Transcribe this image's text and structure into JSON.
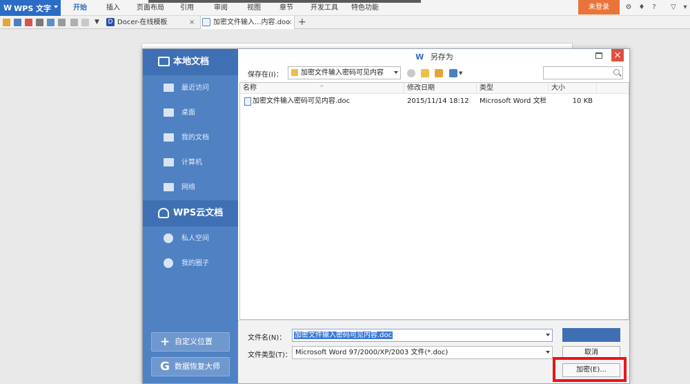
{
  "app": {
    "name": "WPS 文字",
    "logo": "W",
    "menus": [
      "开始",
      "插入",
      "页面布局",
      "引用",
      "审阅",
      "视图",
      "章节",
      "开发工具",
      "特色功能"
    ],
    "active_menu": "开始",
    "login_label": "未登录",
    "accent_color": "#2b6cc4",
    "login_color": "#e8743b"
  },
  "tabs": {
    "docer_label": "Docer-在线模板",
    "docer_icon": "D",
    "active_doc_label": "加密文件输入...内容.doc",
    "close_glyph": "×",
    "add_glyph": "+"
  },
  "dialog": {
    "title": "另存为",
    "title_logo": "W",
    "close_glyph": "×",
    "sidebar": {
      "local_header": "本地文档",
      "local_items": [
        "最近访问",
        "桌面",
        "我的文档",
        "计算机",
        "网络"
      ],
      "cloud_header": "WPS云文档",
      "cloud_items": [
        "私人空间",
        "我的圈子"
      ],
      "custom_location_label": "自定义位置",
      "recovery_label": "数据恢复大师"
    },
    "save_in_label": "保存在(I)：",
    "current_folder": "加密文件输入密码可见内容",
    "columns": [
      "名称",
      "修改日期",
      "类型",
      "大小"
    ],
    "files": [
      {
        "name": "加密文件输入密码可见内容.doc",
        "modified": "2015/11/14 18:12",
        "type": "Microsoft Word 文档",
        "size": "10 KB"
      }
    ],
    "filename_label": "文件名(N)：",
    "filename_value": "加密文件输入密码可见内容.doc",
    "filetype_label": "文件类型(T)：",
    "filetype_value": "Microsoft Word 97/2000/XP/2003 文件(*.doc)",
    "save_button": "",
    "cancel_button": "取消",
    "encrypt_button": "加密(E)..."
  }
}
